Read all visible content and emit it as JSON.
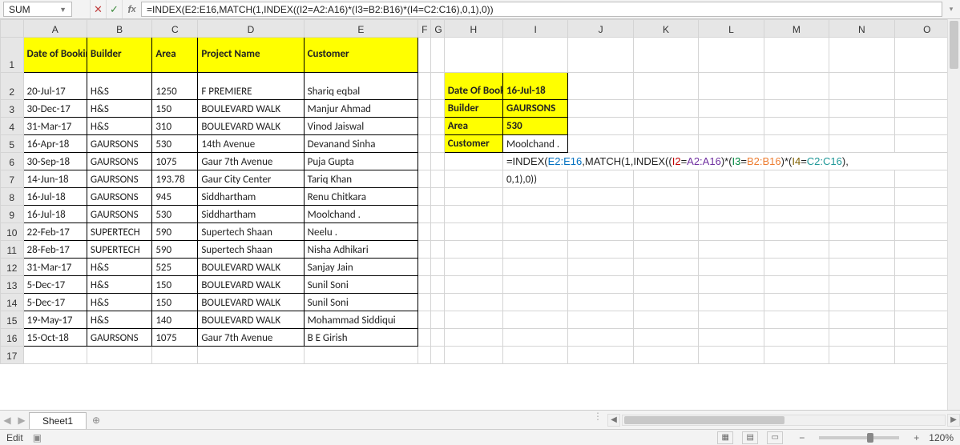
{
  "namebox": "SUM",
  "formula": "=INDEX(E2:E16,MATCH(1,INDEX((I2=A2:A16)*(I3=B2:B16)*(I4=C2:C16),0,1),0))",
  "columns": [
    "A",
    "B",
    "C",
    "D",
    "E",
    "F",
    "G",
    "H",
    "I",
    "J",
    "K",
    "L",
    "M",
    "N",
    "O"
  ],
  "row_count": 17,
  "headers": {
    "A": "Date of Booking",
    "B": "Builder",
    "C": "Area",
    "D": "Project Name",
    "E": "Customer"
  },
  "rows": [
    {
      "A": "20-Jul-17",
      "B": "H&S",
      "C": "1250",
      "D": "F PREMIERE",
      "E": "Shariq eqbal"
    },
    {
      "A": "30-Dec-17",
      "B": "H&S",
      "C": "150",
      "D": "BOULEVARD WALK",
      "E": "Manjur Ahmad"
    },
    {
      "A": "31-Mar-17",
      "B": "H&S",
      "C": "310",
      "D": "BOULEVARD WALK",
      "E": "Vinod Jaiswal"
    },
    {
      "A": "16-Apr-18",
      "B": "GAURSONS",
      "C": "530",
      "D": "14th Avenue",
      "E": "Devanand Sinha"
    },
    {
      "A": "30-Sep-18",
      "B": "GAURSONS",
      "C": "1075",
      "D": "Gaur 7th Avenue",
      "E": "Puja Gupta"
    },
    {
      "A": "14-Jun-18",
      "B": "GAURSONS",
      "C": "193.78",
      "D": "Gaur City Center",
      "E": "Tariq Khan"
    },
    {
      "A": "16-Jul-18",
      "B": "GAURSONS",
      "C": "945",
      "D": "Siddhartham",
      "E": "Renu Chitkara"
    },
    {
      "A": "16-Jul-18",
      "B": "GAURSONS",
      "C": "530",
      "D": "Siddhartham",
      "E": "Moolchand ."
    },
    {
      "A": "22-Feb-17",
      "B": "SUPERTECH",
      "C": "590",
      "D": "Supertech Shaan",
      "E": "Neelu ."
    },
    {
      "A": "28-Feb-17",
      "B": "SUPERTECH",
      "C": "590",
      "D": "Supertech Shaan",
      "E": "Nisha Adhikari"
    },
    {
      "A": "31-Mar-17",
      "B": "H&S",
      "C": "525",
      "D": "BOULEVARD WALK",
      "E": "Sanjay Jain"
    },
    {
      "A": "5-Dec-17",
      "B": "H&S",
      "C": "150",
      "D": "BOULEVARD WALK",
      "E": "Sunil Soni"
    },
    {
      "A": "5-Dec-17",
      "B": "H&S",
      "C": "150",
      "D": "BOULEVARD WALK",
      "E": "Sunil Soni"
    },
    {
      "A": "19-May-17",
      "B": "H&S",
      "C": "140",
      "D": "BOULEVARD WALK",
      "E": "Mohammad Siddiqui"
    },
    {
      "A": "15-Oct-18",
      "B": "GAURSONS",
      "C": "1075",
      "D": "Gaur 7th Avenue",
      "E": "B E Girish"
    }
  ],
  "lookup": {
    "labels": {
      "date": "Date Of Booking",
      "builder": "Builder",
      "area": "Area",
      "customer": "Customer"
    },
    "values": {
      "date": "16-Jul-18",
      "builder": "GAURSONS",
      "area": "530",
      "customer": "Moolchand ."
    }
  },
  "formula_text_line1_pre": "=INDEX(",
  "formula_text_E": "E2:E16",
  "formula_text_mid1": ",MATCH(1,INDEX((",
  "formula_text_I2": "I2",
  "formula_text_eq": "=",
  "formula_text_A": "A2:A16",
  "formula_text_mid2": ")*(",
  "formula_text_I3": "I3",
  "formula_text_B": "B2:B16",
  "formula_text_I4": "I4",
  "formula_text_C": "C2:C16",
  "formula_text_line1_post": "),",
  "formula_text_line2": "0,1),0))",
  "sheet_tab": "Sheet1",
  "status_left": "Edit",
  "zoom": "120%"
}
